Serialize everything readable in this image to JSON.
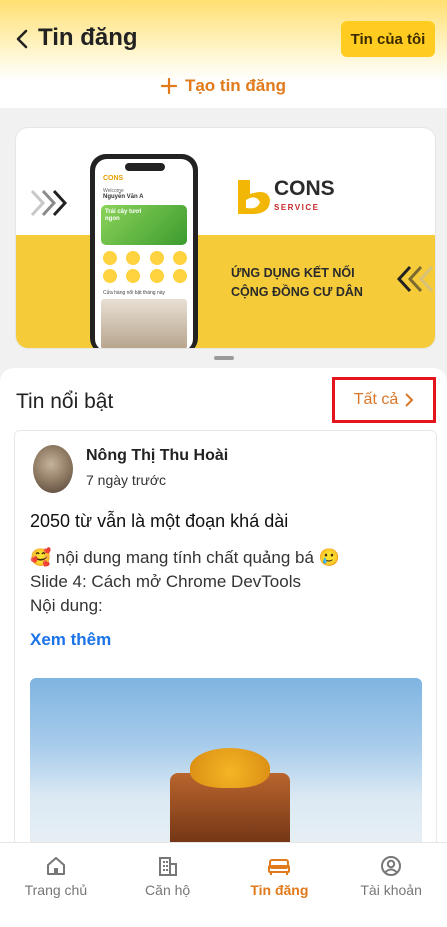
{
  "header": {
    "title": "Tin đăng",
    "my_posts_label": "Tin của tôi",
    "create_label": "Tạo tin đăng"
  },
  "banner": {
    "brand": "CONS",
    "service": "SERVICE",
    "tagline_line1": "ỨNG DỤNG KẾT NỐI",
    "tagline_line2": "CỘNG ĐỒNG CƯ DÂN",
    "phone_welcome": "Welcome",
    "phone_user": "Nguyễn Văn A",
    "phone_promo": "Trái cây tươi ngon",
    "phone_shops": "Cửa hàng nổi bật tháng này"
  },
  "featured": {
    "title": "Tin nổi bật",
    "see_all": "Tất cả",
    "post": {
      "author": "Nông Thị Thu Hoài",
      "time": "7 ngày trước",
      "title": "2050 từ vẫn là một đoạn khá dài",
      "line1": "🥰 nội dung mang tính chất quảng bá 🥲",
      "line2": "Slide 4: Cách mở Chrome DevTools",
      "line3": "Nội dung:",
      "see_more": "Xem thêm"
    }
  },
  "nav": [
    {
      "label": "Trang chủ",
      "icon": "home-icon",
      "active": false
    },
    {
      "label": "Căn hộ",
      "icon": "building-icon",
      "active": false
    },
    {
      "label": "Tin đăng",
      "icon": "bed-icon",
      "active": true
    },
    {
      "label": "Tài khoản",
      "icon": "account-icon",
      "active": false
    }
  ],
  "colors": {
    "accent": "#e07a1a",
    "yellow": "#ffcc1f",
    "link": "#1a73e8",
    "highlight_box": "#e3141b"
  }
}
